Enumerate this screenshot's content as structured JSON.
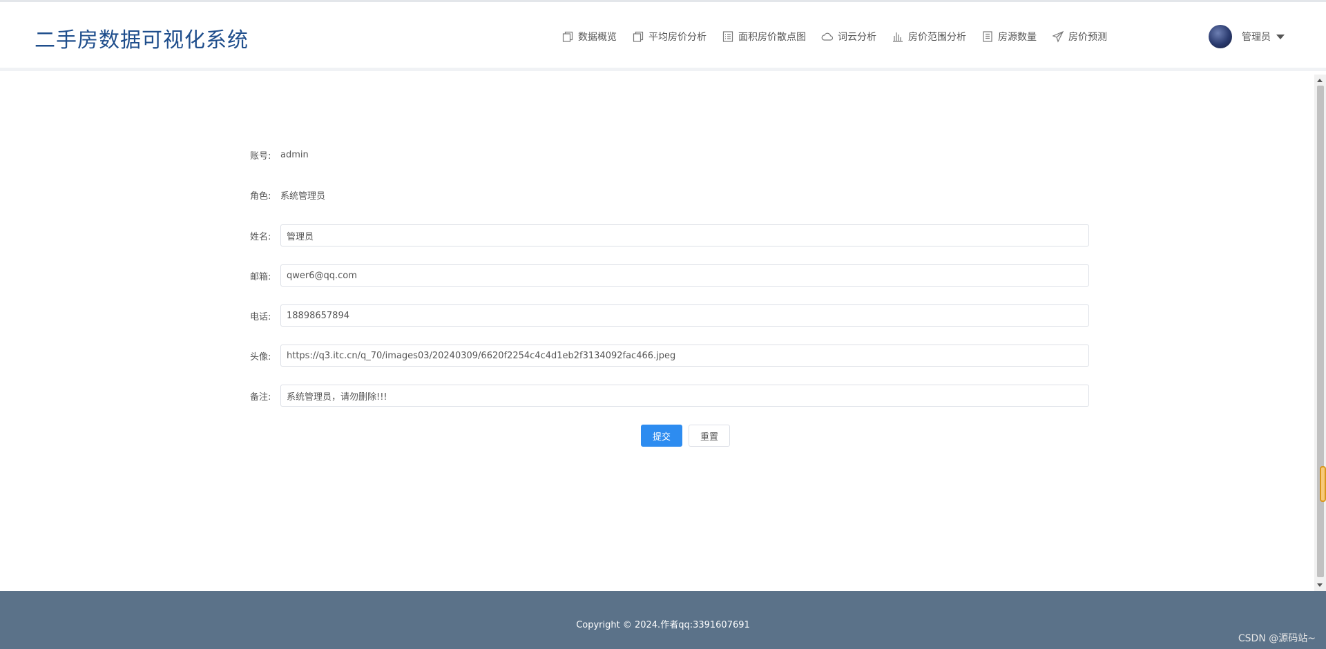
{
  "header": {
    "title": "二手房数据可视化系统",
    "nav": [
      {
        "label": "数据概览",
        "icon": "copy-icon"
      },
      {
        "label": "平均房价分析",
        "icon": "copy-icon"
      },
      {
        "label": "面积房价散点图",
        "icon": "list-icon"
      },
      {
        "label": "词云分析",
        "icon": "cloud-icon"
      },
      {
        "label": "房价范围分析",
        "icon": "bar-chart-icon"
      },
      {
        "label": "房源数量",
        "icon": "document-icon"
      },
      {
        "label": "房价预测",
        "icon": "send-icon"
      }
    ],
    "user": {
      "name": "管理员"
    }
  },
  "form": {
    "account": {
      "label": "账号:",
      "value": "admin"
    },
    "role": {
      "label": "角色:",
      "value": "系统管理员"
    },
    "name": {
      "label": "姓名:",
      "value": "管理员"
    },
    "email": {
      "label": "邮箱:",
      "value": "qwer6@qq.com"
    },
    "phone": {
      "label": "电话:",
      "value": "18898657894"
    },
    "avatar": {
      "label": "头像:",
      "value": "https://q3.itc.cn/q_70/images03/20240309/6620f2254c4c4d1eb2f3134092fac466.jpeg"
    },
    "remark": {
      "label": "备注:",
      "value": "系统管理员，请勿删除!!!"
    },
    "submit_label": "提交",
    "reset_label": "重置"
  },
  "footer": {
    "copyright": "Copyright © 2024.作者qq:3391607691",
    "watermark": "CSDN @源码站~"
  },
  "colors": {
    "brand": "#1f4e8c",
    "primary": "#2d8cf0",
    "footer": "#5b7289"
  }
}
